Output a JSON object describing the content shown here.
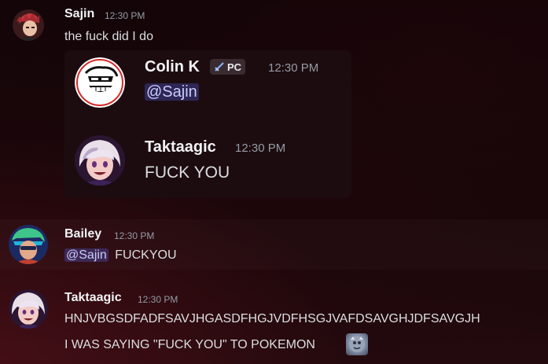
{
  "messages": [
    {
      "author": "Sajin",
      "time": "12:30 PM",
      "text": "the fuck did I do",
      "avatar": "sajin-avatar"
    },
    {
      "author": "Bailey",
      "time": "12:30 PM",
      "mention": "@Sajin",
      "text": "FUCKYOU",
      "avatar": "bailey-avatar"
    },
    {
      "author": "Taktaagic",
      "time": "12:30 PM",
      "line1": "HNJVBGSDFADFSAVJHGASDFHGJVDFHSGJVAFDSAVGHJDFSAVGJH",
      "line2": "I WAS SAYING \"FUCK YOU\" TO POKEMON",
      "emoji": "pokemon-emoji",
      "avatar": "taktaagic-avatar"
    }
  ],
  "embed": {
    "first": {
      "author": "Colin K",
      "tag": "PC",
      "tag_icon": "sword-icon",
      "time": "12:30 PM",
      "mention": "@Sajin",
      "avatar": "colin-avatar"
    },
    "second": {
      "author": "Taktaagic",
      "time": "12:30 PM",
      "text": "FUCK YOU",
      "avatar": "taktaagic-avatar"
    }
  },
  "colors": {
    "background": "#120408",
    "mention_bg": "#58657233",
    "mention_text": "#c9cdfb",
    "timestamp": "#949ba4",
    "username": "#f2f3f5"
  }
}
